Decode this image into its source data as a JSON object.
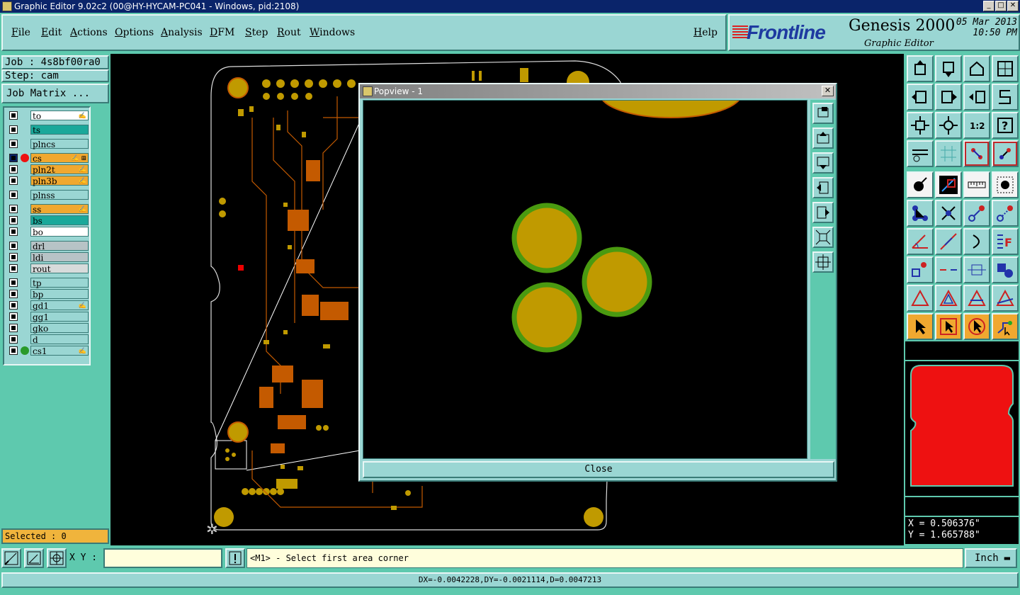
{
  "window": {
    "title": "Graphic Editor 9.02c2 (00@HY-HYCAM-PC041 - Windows, pid:2108)"
  },
  "menu": {
    "items": [
      "File",
      "Edit",
      "Actions",
      "Options",
      "Analysis",
      "DFM",
      "Step",
      "Rout",
      "Windows"
    ],
    "help": "Help"
  },
  "brand": {
    "logo": "Frontline",
    "product": "Genesis 2000",
    "subtitle": "Graphic Editor",
    "date": "05 Mar 2013",
    "time": "10:50 PM"
  },
  "job": {
    "label": "Job : 4s8bf00ra0",
    "step": "Step: cam",
    "matrix_button": "Job Matrix ..."
  },
  "layers": [
    {
      "name": "to",
      "color": "#ffffff",
      "flag": "✍"
    },
    {
      "name": "ts",
      "color": "#1aa89a",
      "flag": ""
    },
    {
      "name": "plncs",
      "color": "#9ad6d3",
      "flag": ""
    },
    {
      "name": "cs",
      "color": "#f0a830",
      "flag": "✍ ⊞",
      "dot": "#ee1111",
      "active": true
    },
    {
      "name": "pln2t",
      "color": "#f0a830",
      "flag": "✍"
    },
    {
      "name": "pln3b",
      "color": "#f0a830",
      "flag": "✍"
    },
    {
      "name": "plnss",
      "color": "#9ad6d3",
      "flag": ""
    },
    {
      "name": "ss",
      "color": "#f0a830",
      "flag": "✍"
    },
    {
      "name": "bs",
      "color": "#1aa89a",
      "flag": ""
    },
    {
      "name": "bo",
      "color": "#ffffff",
      "flag": ""
    },
    {
      "name": "drl",
      "color": "#b7c3c6",
      "flag": ""
    },
    {
      "name": "ldi",
      "color": "#b7c3c6",
      "flag": ""
    },
    {
      "name": "rout",
      "color": "#d7dbdb",
      "flag": ""
    },
    {
      "name": "tp",
      "color": "#9ad6d3",
      "flag": ""
    },
    {
      "name": "bp",
      "color": "#9ad6d3",
      "flag": ""
    },
    {
      "name": "gd1",
      "color": "#9ad6d3",
      "flag": "✍"
    },
    {
      "name": "gg1",
      "color": "#9ad6d3",
      "flag": ""
    },
    {
      "name": "gko",
      "color": "#9ad6d3",
      "flag": ""
    },
    {
      "name": "d",
      "color": "#9ad6d3",
      "flag": ""
    },
    {
      "name": "cs1",
      "color": "#9ad6d3",
      "flag": "✍",
      "dot": "#2a9a2a"
    }
  ],
  "popview": {
    "title": "Popview - 1",
    "close_label": "Close"
  },
  "selected": "Selected : 0",
  "cmd": {
    "xy_label": "X Y :",
    "xy_value": "",
    "prompt": "<M1> - Select first area corner",
    "unit": "Inch"
  },
  "coords": {
    "x": "X = 0.506376\"",
    "y": "Y = 1.665788\""
  },
  "status": "DX=-0.0042228,DY=-0.0021114,D=0.0047213",
  "colors": {
    "pad": "#c09a00",
    "trace": "#c45a00",
    "pad_outline": "#4a9a10",
    "accent": "#9ad6d3"
  }
}
